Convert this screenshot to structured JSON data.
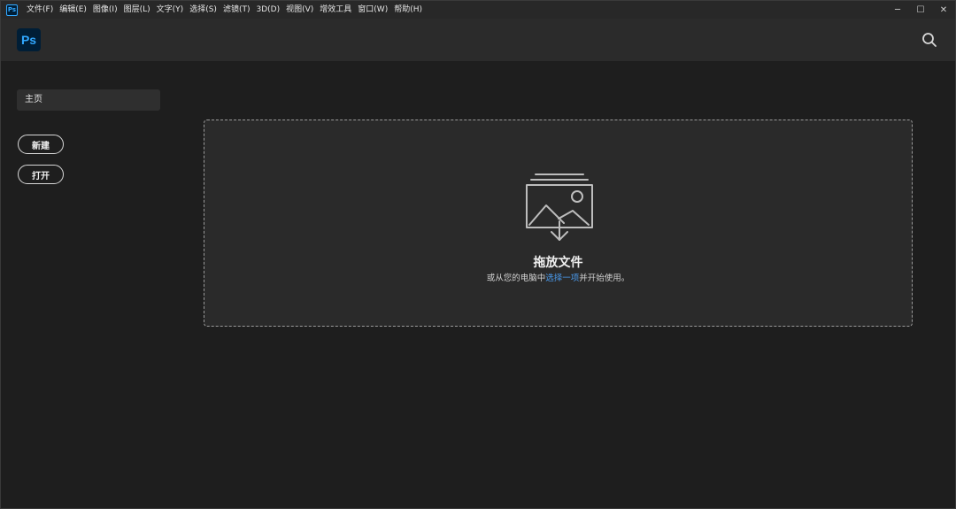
{
  "menubar": {
    "app_icon_text": "Ps",
    "items": [
      "文件(F)",
      "编辑(E)",
      "图像(I)",
      "图层(L)",
      "文字(Y)",
      "选择(S)",
      "滤镜(T)",
      "3D(D)",
      "视图(V)",
      "增效工具",
      "窗口(W)",
      "帮助(H)"
    ],
    "minimize_glyph": "─",
    "maximize_glyph": "☐",
    "close_glyph": "✕"
  },
  "header": {
    "logo_text": "Ps",
    "search_icon": "search-icon"
  },
  "sidebar": {
    "home_label": "主页",
    "new_label": "新建",
    "open_label": "打开"
  },
  "dropzone": {
    "icon": "image-import-icon",
    "title": "拖放文件",
    "subtitle_prefix": "或从您的电脑中",
    "subtitle_link": "选择一项",
    "subtitle_suffix": "并开始使用。"
  },
  "colors": {
    "accent": "#31a8ff",
    "link": "#4b9cf0",
    "background": "#1e1e1e",
    "header": "#2b2b2b"
  }
}
